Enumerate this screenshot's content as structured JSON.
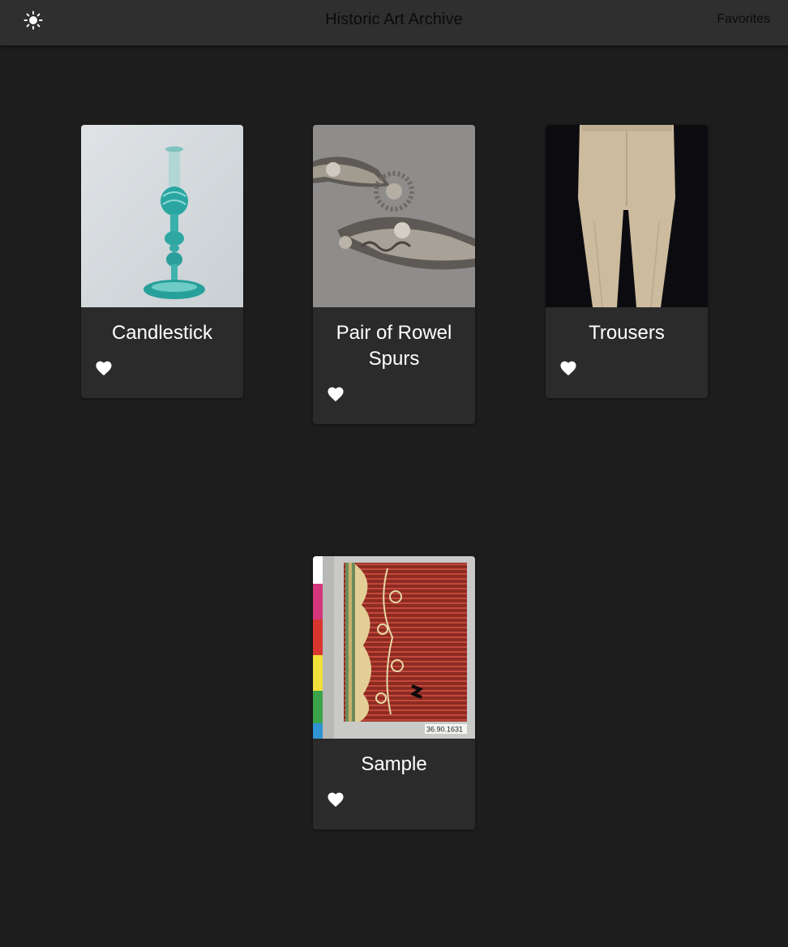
{
  "header": {
    "title": "Historic Art Archive",
    "favorites_label": "Favorites",
    "theme_icon": "sun-icon"
  },
  "cards": [
    {
      "title": "Candlestick",
      "image": "candlestick-image",
      "favorite_icon": "heart-icon"
    },
    {
      "title": "Pair of Rowel Spurs",
      "image": "spurs-image",
      "favorite_icon": "heart-icon"
    },
    {
      "title": "Trousers",
      "image": "trousers-image",
      "favorite_icon": "heart-icon"
    },
    {
      "title": "Sample",
      "image": "textile-sample-image",
      "favorite_icon": "heart-icon",
      "image_label": "36.90.1631"
    }
  ],
  "colors": {
    "background": "#1d1d1d",
    "appbar": "#2f2f2f",
    "card": "#2b2b2b",
    "text": "#ffffff",
    "header_text": "#0b0b0b"
  }
}
